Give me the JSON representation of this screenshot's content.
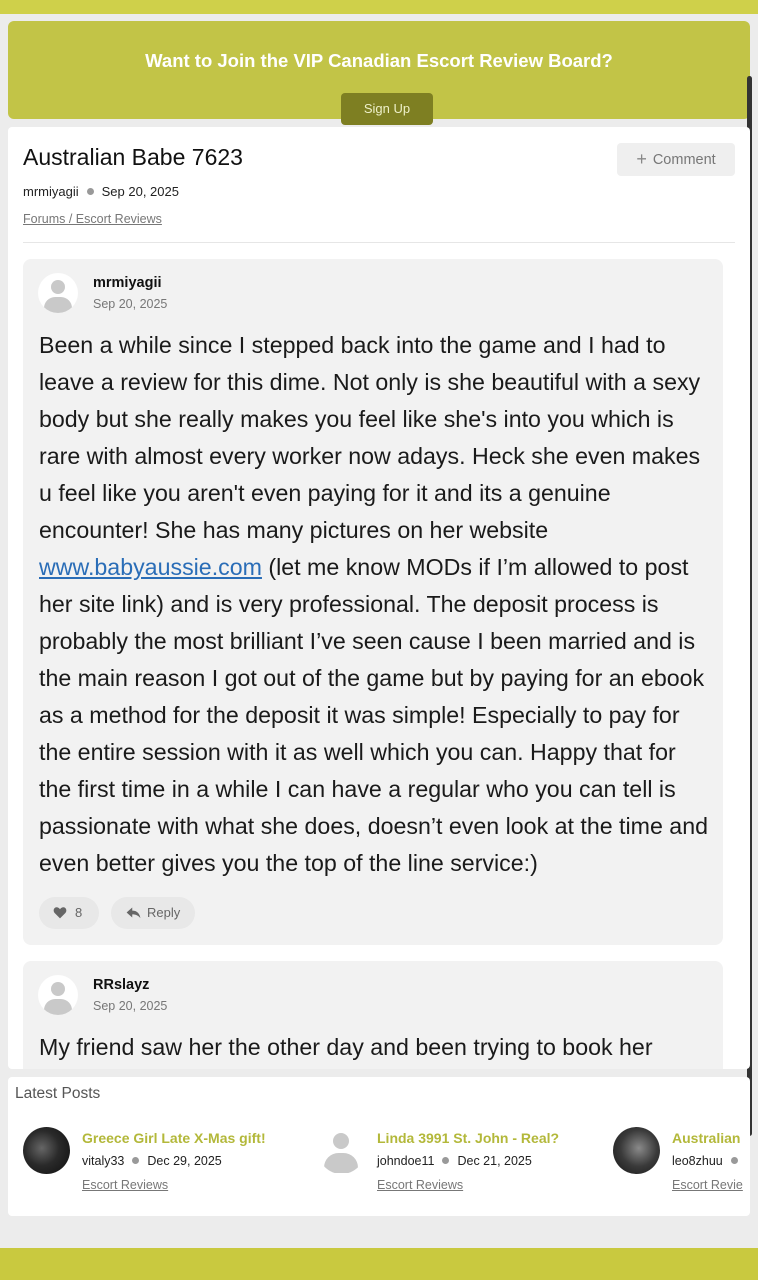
{
  "banner": {
    "title": "Want to Join the VIP Canadian Escort Review Board?",
    "signup_label": "Sign Up"
  },
  "thread": {
    "title": "Australian Babe 7623",
    "author": "mrmiyagii",
    "date": "Sep 20, 2025",
    "breadcrumb": "Forums / Escort Reviews",
    "comment_label": "Comment"
  },
  "posts": [
    {
      "author": "mrmiyagii",
      "date": "Sep 20, 2025",
      "body_before_link": "Been a while since I stepped back into the game and I had to leave a review for this dime. Not only is she beautiful with a sexy body but she really makes you feel like she's into you which is rare with almost every worker now adays. Heck she even makes u feel like you aren't even paying for it and its a genuine encounter! She has many pictures on her website ",
      "link_text": "www.babyaussie.com",
      "body_after_link": " (let me know MODs if I’m allowed to post her site link) and is very professional. The deposit process is probably the most brilliant I’ve seen cause I been married and is the main reason I got out of the game but by paying for an ebook as a method for the deposit it was simple! Especially to pay for the entire session with it as well which you can. Happy that for the first time in a while I can have a regular who you can tell is passionate with what she does, doesn’t even look at the time and even better gives you the top of the line service:)",
      "likes": "8",
      "reply_label": "Reply"
    },
    {
      "author": "RRslayz",
      "date": "Sep 20, 2025",
      "body": "My friend saw her the other day and been trying to book her"
    }
  ],
  "latest": {
    "title": "Latest Posts",
    "items": [
      {
        "title": "Greece Girl Late X-Mas gift!",
        "author": "vitaly33",
        "date": "Dec 29, 2025",
        "category": "Escort Reviews"
      },
      {
        "title": "Linda 3991 St. John - Real?",
        "author": "johndoe11",
        "date": "Dec 21, 2025",
        "category": "Escort Reviews"
      },
      {
        "title": "Australian",
        "author": "leo8zhuu",
        "date": "",
        "category": "Escort Revie"
      }
    ]
  },
  "colors": {
    "accent": "#c2c447",
    "link": "#2a6db7",
    "post_title": "#b3b83a"
  }
}
